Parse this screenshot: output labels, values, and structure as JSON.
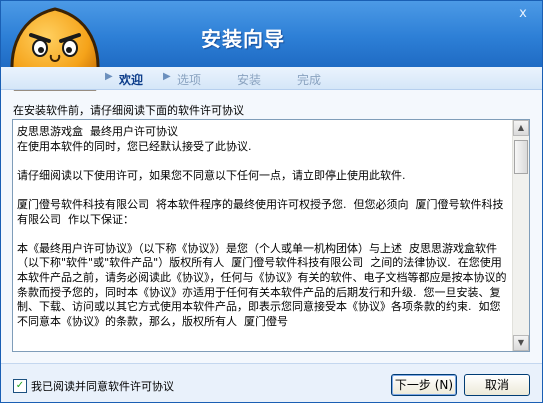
{
  "window": {
    "title": "安装向导",
    "close_glyph": "x"
  },
  "steps": [
    "欢迎",
    "选项",
    "安装",
    "完成"
  ],
  "step_arrow": "▶",
  "instruction": "在安装软件前，请仔细阅读下面的软件许可协议",
  "license": {
    "paragraphs": [
      "皮思思游戏盒  最终用户许可协议\n在使用本软件的同时，您已经默认接受了此协议.",
      "请仔细阅读以下使用许可，如果您不同意以下任何一点，请立即停止使用此软件.",
      "厦门僜号软件科技有限公司  将本软件程序的最终使用许可权授予您.  但您必须向  厦门僜号软件科技有限公司  作以下保证：",
      "本《最终用户许可协议》（以下称《协议》）是您（个人或单一机构团体）与上述  皮思思游戏盒软件（以下称\"软件\"或\"软件产品\"）版权所有人  厦门僜号软件科技有限公司  之间的法律协议.  在您使用本软件产品之前，请务必阅读此《协议》，任何与《协议》有关的软件、电子文档等都应是按本协议的条款而授予您的，同时本《协议》亦适用于任何有关本软件产品的后期发行和升级.  您一旦安装、复制、下载、访问或以其它方式使用本软件产品，即表示您同意接受本《协议》各项条款的约束.  如您不同意本《协议》的条款，那么，版权所有人  厦门僜号"
    ]
  },
  "footer": {
    "agree_label": "我已阅读并同意软件许可协议",
    "agree_checked": true,
    "checkmark": "✓",
    "next_button": "下一步 (N)",
    "cancel_button": "取消"
  },
  "scrollbar": {
    "up": "▲",
    "down": "▼"
  },
  "colors": {
    "header": "#2d7fd6",
    "active_step": "#0d3d8a",
    "inactive_step": "#8aa3c0",
    "mascot": "#f5a31a"
  },
  "icons": [
    "mascot-logo",
    "close-icon",
    "checkbox-check-icon",
    "scroll-up-icon",
    "scroll-down-icon"
  ]
}
